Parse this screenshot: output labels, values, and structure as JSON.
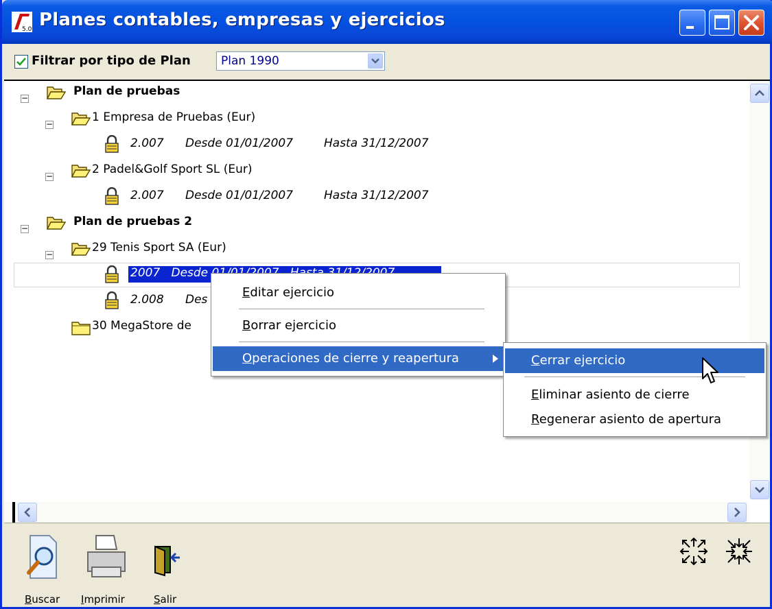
{
  "window": {
    "title": "Planes contables, empresas y ejercicios",
    "logo_text": "5.0"
  },
  "filter": {
    "checkbox_label": "Filtrar por tipo de Plan",
    "checked": true,
    "select_value": "Plan 1990"
  },
  "tree": {
    "plan1": {
      "label": "Plan de pruebas",
      "company1": {
        "label": "1 Empresa de Pruebas (Eur)",
        "year": "2.007",
        "desde": "Desde 01/01/2007",
        "hasta": "Hasta 31/12/2007"
      },
      "company2": {
        "label": "2 Padel&Golf Sport SL (Eur)",
        "year": "2.007",
        "desde": "Desde 01/01/2007",
        "hasta": "Hasta 31/12/2007"
      }
    },
    "plan2": {
      "label": "Plan de pruebas 2",
      "company1": {
        "label": "29 Tenis Sport SA (Eur)",
        "year_selected": "2007",
        "desde_selected": "Desde 01/01/2007",
        "hasta_selected": "Hasta 31/12/2007",
        "year2": "2.008",
        "desde2": "Des"
      },
      "company2": {
        "label": "30 MegaStore de"
      }
    }
  },
  "context_menu": {
    "items": [
      {
        "pre": "",
        "key": "E",
        "post": "ditar ejercicio"
      },
      {
        "pre": "",
        "key": "B",
        "post": "orrar ejercicio"
      },
      {
        "pre": "",
        "key": "O",
        "post": "peraciones de cierre y reapertura"
      }
    ],
    "submenu": [
      {
        "pre": "",
        "key": "C",
        "post": "errar ejercicio"
      },
      {
        "pre": "",
        "key": "E",
        "post": "liminar asiento de cierre"
      },
      {
        "pre": "",
        "key": "R",
        "post": "egenerar asiento de apertura"
      }
    ]
  },
  "toolbar": {
    "search": {
      "key": "B",
      "post": "uscar"
    },
    "print": {
      "key": "I",
      "post": "mprimir"
    },
    "exit": {
      "key": "S",
      "post": "alir"
    }
  },
  "colors": {
    "titlebar": "#0551e0",
    "selection": "#0a24d0",
    "menu_highlight": "#316ac5"
  }
}
